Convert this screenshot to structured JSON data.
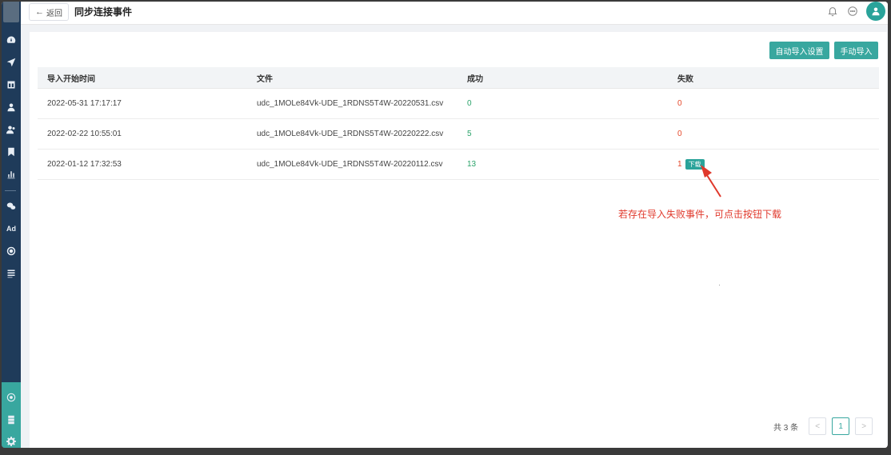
{
  "header": {
    "back_label": "返回",
    "title": "同步连接事件"
  },
  "toolbar": {
    "auto_import_label": "自动导入设置",
    "manual_import_label": "手动导入"
  },
  "table": {
    "columns": [
      "导入开始时间",
      "文件",
      "成功",
      "失败"
    ],
    "rows": [
      {
        "start_time": "2022-05-31 17:17:17",
        "file": "udc_1MOLe84Vk-UDE_1RDNS5T4W-20220531.csv",
        "success": "0",
        "failed": "0"
      },
      {
        "start_time": "2022-02-22 10:55:01",
        "file": "udc_1MOLe84Vk-UDE_1RDNS5T4W-20220222.csv",
        "success": "5",
        "failed": "0"
      },
      {
        "start_time": "2022-01-12 17:32:53",
        "file": "udc_1MOLe84Vk-UDE_1RDNS5T4W-20220112.csv",
        "success": "13",
        "failed": "1",
        "download_label": "下载"
      }
    ]
  },
  "annotation": {
    "text": "若存在导入失败事件，可点击按钮下载",
    "color": "#e0392c"
  },
  "pagination": {
    "total": "共 3 条",
    "prev": "<",
    "current": "1",
    "next": ">"
  },
  "colors": {
    "accent": "#38a79f",
    "sidebar": "#1f3b5a",
    "success": "#2aa36a",
    "fail": "#e5482a"
  },
  "icons": {
    "sidebar": [
      "dashboard-icon",
      "send-icon",
      "table-icon",
      "user-icon",
      "users-icon",
      "bookmark-icon",
      "bar-chart-icon",
      "wechat-icon",
      "ad-icon",
      "target-icon",
      "list-icon",
      "connection-icon",
      "stack-icon",
      "gear-icon"
    ],
    "header": [
      "bell-icon",
      "chat-icon",
      "user-avatar-icon"
    ]
  },
  "sidebar": {
    "ad_label": "Ad"
  }
}
